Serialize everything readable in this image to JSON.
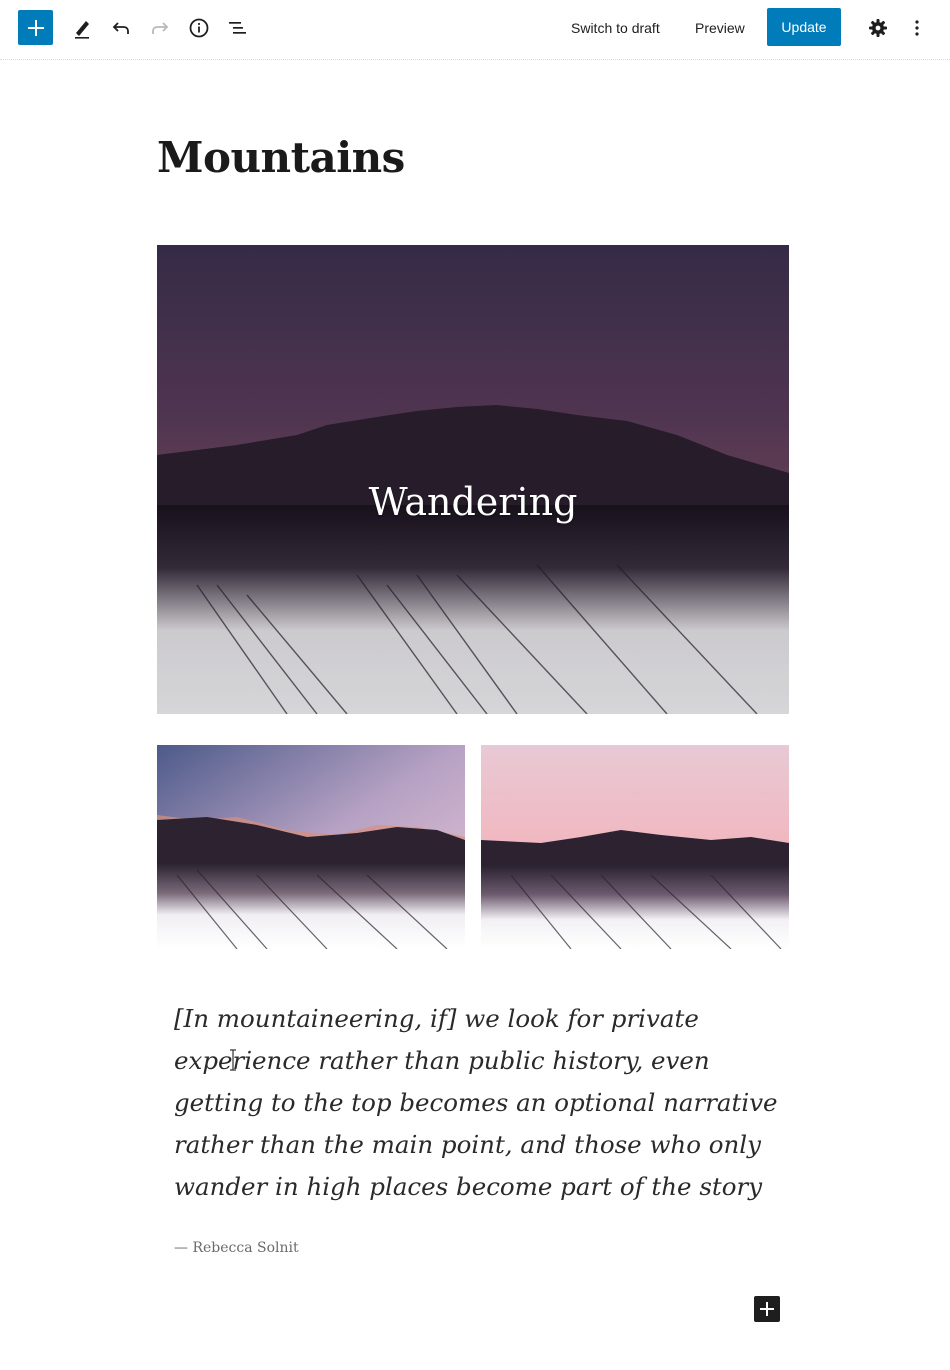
{
  "toolbar": {
    "inserter_icon": "plus-icon",
    "tools_icon": "pencil-icon",
    "undo_icon": "undo-icon",
    "redo_icon": "redo-icon",
    "details_icon": "info-icon",
    "outline_icon": "list-view-icon",
    "switch_to_draft": "Switch to draft",
    "preview": "Preview",
    "update": "Update",
    "settings_icon": "gear-icon",
    "more_icon": "more-vertical-icon"
  },
  "post": {
    "title": "Mountains"
  },
  "cover": {
    "title": "Wandering"
  },
  "quote": {
    "lines": [
      "[In mountaineering, if] we look for private",
      "experience rather than public history, even",
      "getting to the top becomes an optional narrative",
      "rather than the main point, and those who only",
      "wander in high places become part of the story"
    ],
    "citation": "— Rebecca Solnit"
  },
  "colors": {
    "accent": "#007cba",
    "text": "#1e1e1e"
  }
}
